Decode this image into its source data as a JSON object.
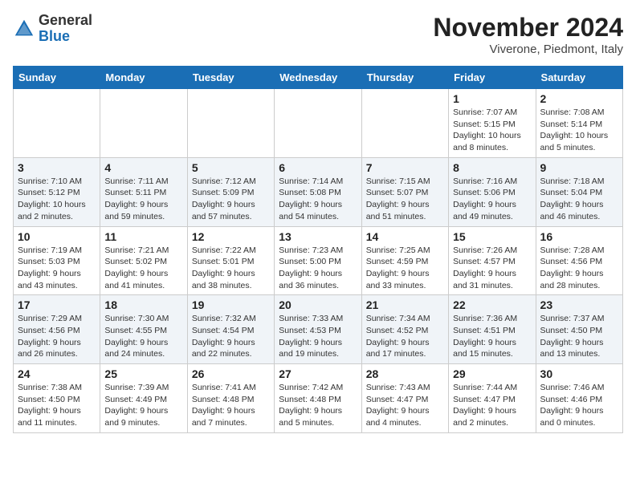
{
  "header": {
    "logo_line1": "General",
    "logo_line2": "Blue",
    "month": "November 2024",
    "location": "Viverone, Piedmont, Italy"
  },
  "weekdays": [
    "Sunday",
    "Monday",
    "Tuesday",
    "Wednesday",
    "Thursday",
    "Friday",
    "Saturday"
  ],
  "weeks": [
    [
      {
        "day": "",
        "info": ""
      },
      {
        "day": "",
        "info": ""
      },
      {
        "day": "",
        "info": ""
      },
      {
        "day": "",
        "info": ""
      },
      {
        "day": "",
        "info": ""
      },
      {
        "day": "1",
        "info": "Sunrise: 7:07 AM\nSunset: 5:15 PM\nDaylight: 10 hours\nand 8 minutes."
      },
      {
        "day": "2",
        "info": "Sunrise: 7:08 AM\nSunset: 5:14 PM\nDaylight: 10 hours\nand 5 minutes."
      }
    ],
    [
      {
        "day": "3",
        "info": "Sunrise: 7:10 AM\nSunset: 5:12 PM\nDaylight: 10 hours\nand 2 minutes."
      },
      {
        "day": "4",
        "info": "Sunrise: 7:11 AM\nSunset: 5:11 PM\nDaylight: 9 hours\nand 59 minutes."
      },
      {
        "day": "5",
        "info": "Sunrise: 7:12 AM\nSunset: 5:09 PM\nDaylight: 9 hours\nand 57 minutes."
      },
      {
        "day": "6",
        "info": "Sunrise: 7:14 AM\nSunset: 5:08 PM\nDaylight: 9 hours\nand 54 minutes."
      },
      {
        "day": "7",
        "info": "Sunrise: 7:15 AM\nSunset: 5:07 PM\nDaylight: 9 hours\nand 51 minutes."
      },
      {
        "day": "8",
        "info": "Sunrise: 7:16 AM\nSunset: 5:06 PM\nDaylight: 9 hours\nand 49 minutes."
      },
      {
        "day": "9",
        "info": "Sunrise: 7:18 AM\nSunset: 5:04 PM\nDaylight: 9 hours\nand 46 minutes."
      }
    ],
    [
      {
        "day": "10",
        "info": "Sunrise: 7:19 AM\nSunset: 5:03 PM\nDaylight: 9 hours\nand 43 minutes."
      },
      {
        "day": "11",
        "info": "Sunrise: 7:21 AM\nSunset: 5:02 PM\nDaylight: 9 hours\nand 41 minutes."
      },
      {
        "day": "12",
        "info": "Sunrise: 7:22 AM\nSunset: 5:01 PM\nDaylight: 9 hours\nand 38 minutes."
      },
      {
        "day": "13",
        "info": "Sunrise: 7:23 AM\nSunset: 5:00 PM\nDaylight: 9 hours\nand 36 minutes."
      },
      {
        "day": "14",
        "info": "Sunrise: 7:25 AM\nSunset: 4:59 PM\nDaylight: 9 hours\nand 33 minutes."
      },
      {
        "day": "15",
        "info": "Sunrise: 7:26 AM\nSunset: 4:57 PM\nDaylight: 9 hours\nand 31 minutes."
      },
      {
        "day": "16",
        "info": "Sunrise: 7:28 AM\nSunset: 4:56 PM\nDaylight: 9 hours\nand 28 minutes."
      }
    ],
    [
      {
        "day": "17",
        "info": "Sunrise: 7:29 AM\nSunset: 4:56 PM\nDaylight: 9 hours\nand 26 minutes."
      },
      {
        "day": "18",
        "info": "Sunrise: 7:30 AM\nSunset: 4:55 PM\nDaylight: 9 hours\nand 24 minutes."
      },
      {
        "day": "19",
        "info": "Sunrise: 7:32 AM\nSunset: 4:54 PM\nDaylight: 9 hours\nand 22 minutes."
      },
      {
        "day": "20",
        "info": "Sunrise: 7:33 AM\nSunset: 4:53 PM\nDaylight: 9 hours\nand 19 minutes."
      },
      {
        "day": "21",
        "info": "Sunrise: 7:34 AM\nSunset: 4:52 PM\nDaylight: 9 hours\nand 17 minutes."
      },
      {
        "day": "22",
        "info": "Sunrise: 7:36 AM\nSunset: 4:51 PM\nDaylight: 9 hours\nand 15 minutes."
      },
      {
        "day": "23",
        "info": "Sunrise: 7:37 AM\nSunset: 4:50 PM\nDaylight: 9 hours\nand 13 minutes."
      }
    ],
    [
      {
        "day": "24",
        "info": "Sunrise: 7:38 AM\nSunset: 4:50 PM\nDaylight: 9 hours\nand 11 minutes."
      },
      {
        "day": "25",
        "info": "Sunrise: 7:39 AM\nSunset: 4:49 PM\nDaylight: 9 hours\nand 9 minutes."
      },
      {
        "day": "26",
        "info": "Sunrise: 7:41 AM\nSunset: 4:48 PM\nDaylight: 9 hours\nand 7 minutes."
      },
      {
        "day": "27",
        "info": "Sunrise: 7:42 AM\nSunset: 4:48 PM\nDaylight: 9 hours\nand 5 minutes."
      },
      {
        "day": "28",
        "info": "Sunrise: 7:43 AM\nSunset: 4:47 PM\nDaylight: 9 hours\nand 4 minutes."
      },
      {
        "day": "29",
        "info": "Sunrise: 7:44 AM\nSunset: 4:47 PM\nDaylight: 9 hours\nand 2 minutes."
      },
      {
        "day": "30",
        "info": "Sunrise: 7:46 AM\nSunset: 4:46 PM\nDaylight: 9 hours\nand 0 minutes."
      }
    ]
  ]
}
